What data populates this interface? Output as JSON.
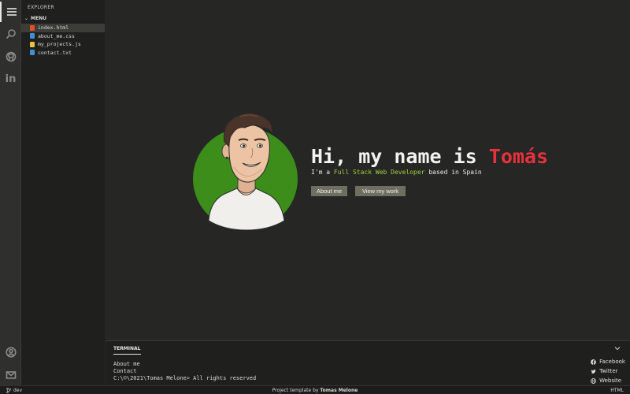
{
  "activity_bar": {
    "top_icons": [
      "menu-icon",
      "search-icon",
      "github-icon",
      "linkedin-icon"
    ],
    "linkedin_text": "in",
    "bottom_icons": [
      "account-icon",
      "mail-icon"
    ]
  },
  "explorer": {
    "title": "EXPLORER",
    "section": "MENU",
    "files": [
      {
        "name": "index.html",
        "icon": "html-file-icon",
        "color": "#e44d26",
        "active": true
      },
      {
        "name": "about_me.css",
        "icon": "css-file-icon",
        "color": "#3e8fd6",
        "active": false
      },
      {
        "name": "my_projects.js",
        "icon": "js-file-icon",
        "color": "#e8c33d",
        "active": false
      },
      {
        "name": "contact.txt",
        "icon": "txt-file-icon",
        "color": "#3e8fd6",
        "active": false
      }
    ]
  },
  "hero": {
    "greeting_prefix": "Hi, my name is ",
    "name": "Tomás",
    "subtitle_prefix": "I'm a ",
    "role": "Full Stack Web Developer",
    "subtitle_suffix": " based in Spain",
    "about_button": "About me",
    "work_button": "View my work",
    "colors": {
      "name": "#e5323c",
      "role": "#9fd33c",
      "avatar_bg": "#3c8d1a"
    }
  },
  "terminal": {
    "tab_label": "TERMINAL",
    "lines": [
      "About me",
      "Contact",
      "C:\\©\\2021\\Tomas Melone> All rights reserved"
    ],
    "social": [
      {
        "label": "Facebook",
        "icon": "facebook-icon"
      },
      {
        "label": "Twitter",
        "icon": "twitter-icon"
      },
      {
        "label": "Website",
        "icon": "globe-icon"
      }
    ]
  },
  "status_bar": {
    "branch": "dev",
    "center_prefix": "Project template by ",
    "center_author": "Tomas Melone",
    "language": "HTML"
  }
}
